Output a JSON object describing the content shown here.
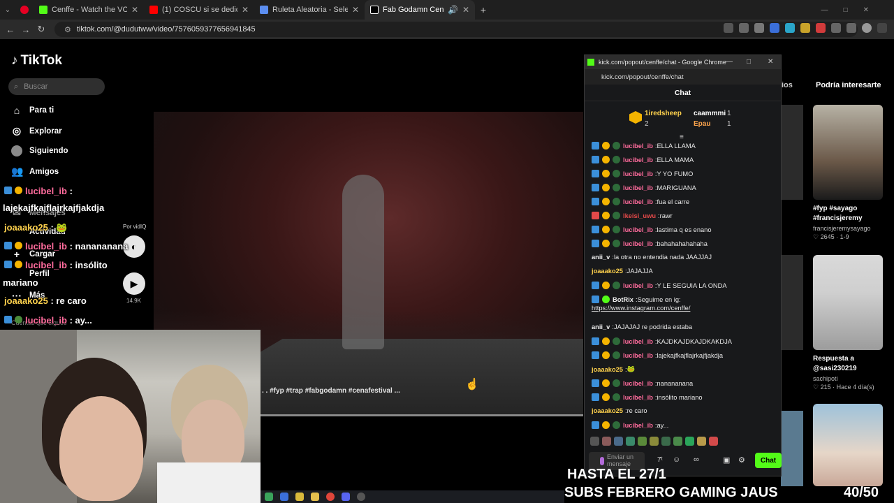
{
  "browser": {
    "tabs": [
      {
        "label": "Cenffe - Watch the VOD on",
        "color": "#53fc18"
      },
      {
        "label": "(1) COSCU si se dedicara a sac",
        "color": "#ff0000"
      },
      {
        "label": "Ruleta Aleatoria - Selector Pers",
        "color": "#5b8def"
      },
      {
        "label": "Fab Godamn Cena Festival",
        "color": "#ffffff"
      }
    ],
    "url": "tiktok.com/@dudutww/video/7576059377656941845"
  },
  "tiktok": {
    "logo": "TikTok",
    "search_placeholder": "Buscar",
    "nav": [
      "Para ti",
      "Explorar",
      "Siguiendo",
      "Amigos",
      "Mensajes",
      "Actividad",
      "Cargar",
      "Perfil",
      "Más"
    ],
    "following_label": "Cuentas que sigues",
    "caption": ". . #fyp #trap #fabgodamn #cenafestival ...",
    "vidiq_label": "Por vidIQ",
    "view_count": "14.9K",
    "recs_title": "Podría interesarte",
    "recs": [
      {
        "title": "#fyp #sayago #francisjeremy",
        "author": "francisjeremysayago",
        "meta": "♡ 2645 · 1-9"
      },
      {
        "title": "Respuesta a @sasi230219",
        "author": "sachipoti",
        "meta": "♡ 215 · Hace 4 día(s)"
      }
    ]
  },
  "overlay_chat": [
    {
      "user": "lucibel_ib",
      "text": " :"
    },
    {
      "user": "",
      "text": "lajekajfkajflajrkajfjakdja"
    },
    {
      "user": "joaaako25",
      "text": " : 🐸"
    },
    {
      "user": "lucibel_ib",
      "text": " : nanananana"
    },
    {
      "user": "lucibel_ib",
      "text": " : insólito"
    },
    {
      "user": "",
      "text": "mariano"
    },
    {
      "user": "joaaako25",
      "text": " : re caro"
    },
    {
      "user": "lucibel_ib",
      "text": " : ay..."
    }
  ],
  "kick": {
    "window_title": "kick.com/popout/cenffe/chat - Google Chrome",
    "url": "kick.com/popout/cenffe/chat",
    "header": "Chat",
    "leaderboard": {
      "first_user": "1iredsheep",
      "first_count": "2",
      "second_user": "caammmi",
      "second_count": "1",
      "third_user": "Epau",
      "third_count": "1"
    },
    "messages": [
      {
        "user": "lucibel_ib",
        "text": "ELLA LLAMA",
        "style": "pink"
      },
      {
        "user": "lucibel_ib",
        "text": "ELLA MAMA",
        "style": "pink"
      },
      {
        "user": "lucibel_ib",
        "text": "Y YO FUMO",
        "style": "pink"
      },
      {
        "user": "lucibel_ib",
        "text": "MARIGUANA",
        "style": "pink"
      },
      {
        "user": "lucibel_ib",
        "text": "fua el carre",
        "style": "pink"
      },
      {
        "user": "lkeisi_uwu",
        "text": "rawr",
        "style": "red"
      },
      {
        "user": "lucibel_ib",
        "text": "lastima q es enano",
        "style": "pink"
      },
      {
        "user": "lucibel_ib",
        "text": "bahahahahahaha",
        "style": "pink"
      },
      {
        "user": "anii_v",
        "text": "la otra no entendia nada JAAJJAJ",
        "style": "plain"
      },
      {
        "user": "joaaako25",
        "text": "JAJAJJA",
        "style": "yellow"
      },
      {
        "user": "lucibel_ib",
        "text": "Y LE SEGUIA LA ONDA",
        "style": "pink"
      },
      {
        "user": "BotRix",
        "text": "Seguime en ig:",
        "style": "bot"
      },
      {
        "user": "",
        "text": "https://www.instagram.com/cenffe/",
        "style": "link"
      },
      {
        "user": "anii_v",
        "text": "JAJAJAJ re podrida estaba",
        "style": "plain"
      },
      {
        "user": "lucibel_ib",
        "text": "KAJDKAJDKAJDKAKDJA",
        "style": "pink"
      },
      {
        "user": "lucibel_ib",
        "text": "lajekajfkajflajrkajfjakdja",
        "style": "pink"
      },
      {
        "user": "joaaako25",
        "text": "🐸",
        "style": "yellow"
      },
      {
        "user": "lucibel_ib",
        "text": "nanananana",
        "style": "pink"
      },
      {
        "user": "lucibel_ib",
        "text": "insólito mariano",
        "style": "pink"
      },
      {
        "user": "joaaako25",
        "text": "re caro",
        "style": "yellow"
      },
      {
        "user": "lucibel_ib",
        "text": "ay...",
        "style": "pink"
      }
    ],
    "input_placeholder": "Enviar un mensaje",
    "send_label": "Chat"
  },
  "stream_overlay": {
    "line1": "HASTA EL 27/1",
    "line2": "SUBS FEBRERO GAMING JAUS",
    "counter": "40/50"
  },
  "colors": {
    "kick_green": "#53fc18",
    "pink_user": "#ff6b9c",
    "yellow_user": "#ffd24d"
  }
}
